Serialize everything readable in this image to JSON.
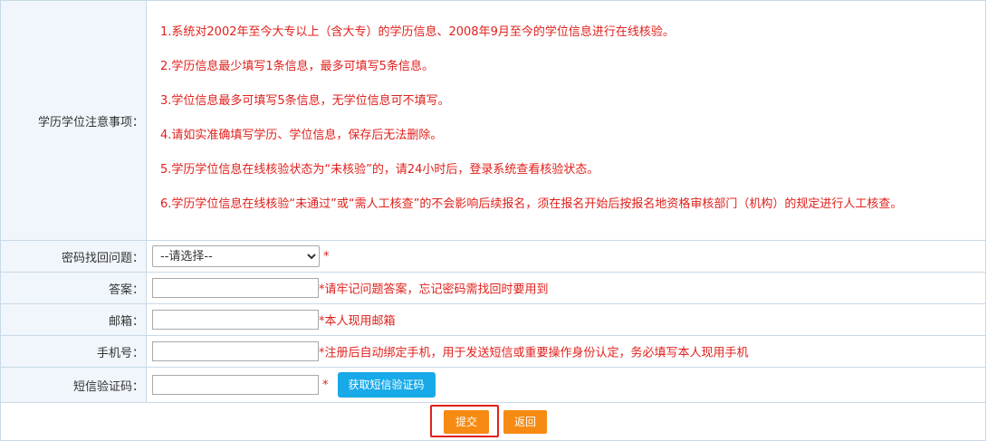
{
  "notes": {
    "label": "学历学位注意事项：",
    "items": [
      "1.系统对2002年至今大专以上（含大专）的学历信息、2008年9月至今的学位信息进行在线核验。",
      "2.学历信息最少填写1条信息，最多可填写5条信息。",
      "3.学位信息最多可填写5条信息，无学位信息可不填写。",
      "4.请如实准确填写学历、学位信息，保存后无法删除。",
      "5.学历学位信息在线核验状态为“未核验”的，请24小时后，登录系统查看核验状态。",
      "6.学历学位信息在线核验“未通过”或“需人工核查”的不会影响后续报名，须在报名开始后按报名地资格审核部门（机构）的规定进行人工核查。"
    ]
  },
  "security_question": {
    "label": "密码找回问题：",
    "selected": "--请选择--",
    "required_mark": "*"
  },
  "answer": {
    "label": "答案：",
    "value": "",
    "hint": "*请牢记问题答案，忘记密码需找回时要用到"
  },
  "email": {
    "label": "邮箱：",
    "value": "",
    "hint": "*本人现用邮箱"
  },
  "phone": {
    "label": "手机号：",
    "value": "",
    "hint": "*注册后自动绑定手机，用于发送短信或重要操作身份认定，务必填写本人现用手机"
  },
  "sms_code": {
    "label": "短信验证码：",
    "value": "",
    "required_mark": "*",
    "button_label": "获取短信验证码"
  },
  "actions": {
    "submit_label": "提交",
    "back_label": "返回"
  },
  "colors": {
    "accent_orange": "#f68a12",
    "accent_blue": "#18a9e8",
    "notice_red": "#e0201c",
    "label_bg": "#f0f6fb"
  }
}
